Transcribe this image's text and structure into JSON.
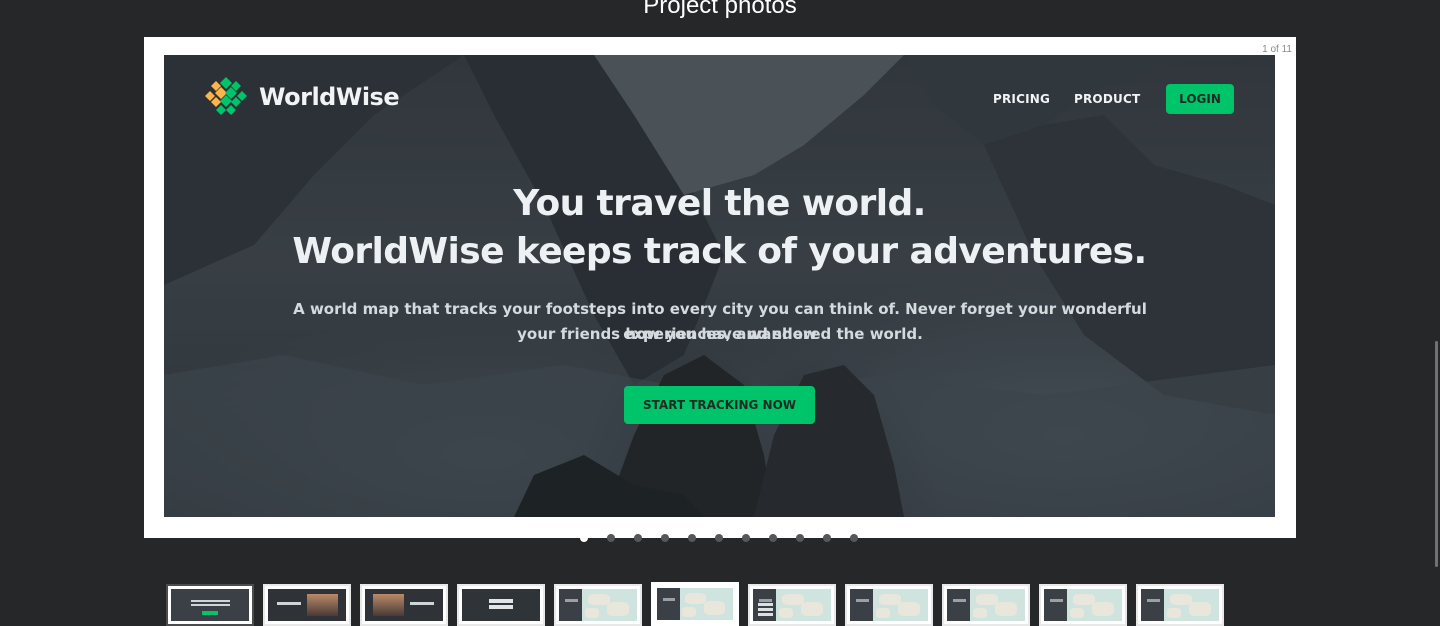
{
  "page": {
    "title": "Project photos"
  },
  "viewer": {
    "counter": "1 of 11",
    "total": 11,
    "current": 1
  },
  "slide": {
    "brand": "WorldWise",
    "nav": {
      "pricing": "PRICING",
      "product": "PRODUCT",
      "login": "LOGIN"
    },
    "headline_line1": "You travel the world.",
    "headline_line2": "WorldWise keeps track of your adventures.",
    "subtext_line1": "A world map that tracks your footsteps into every city you can think of. Never forget your wonderful experiences, and show",
    "subtext_line2": "your friends how you have wandered the world.",
    "cta": "START TRACKING NOW",
    "colors": {
      "accent": "#00c46a",
      "text": "#f1f3f5"
    }
  },
  "thumbnails": [
    {
      "index": 1,
      "kind": "hero"
    },
    {
      "index": 2,
      "kind": "split-photo"
    },
    {
      "index": 3,
      "kind": "split-photo"
    },
    {
      "index": 4,
      "kind": "form"
    },
    {
      "index": 5,
      "kind": "map"
    },
    {
      "index": 6,
      "kind": "map",
      "active": true
    },
    {
      "index": 7,
      "kind": "map-list"
    },
    {
      "index": 8,
      "kind": "map"
    },
    {
      "index": 9,
      "kind": "map"
    },
    {
      "index": 10,
      "kind": "map"
    },
    {
      "index": 11,
      "kind": "map"
    }
  ],
  "colors": {
    "background": "#262728",
    "frame": "#ffffff",
    "dot_active": "#ffffff",
    "dot_inactive": "#55585b"
  }
}
